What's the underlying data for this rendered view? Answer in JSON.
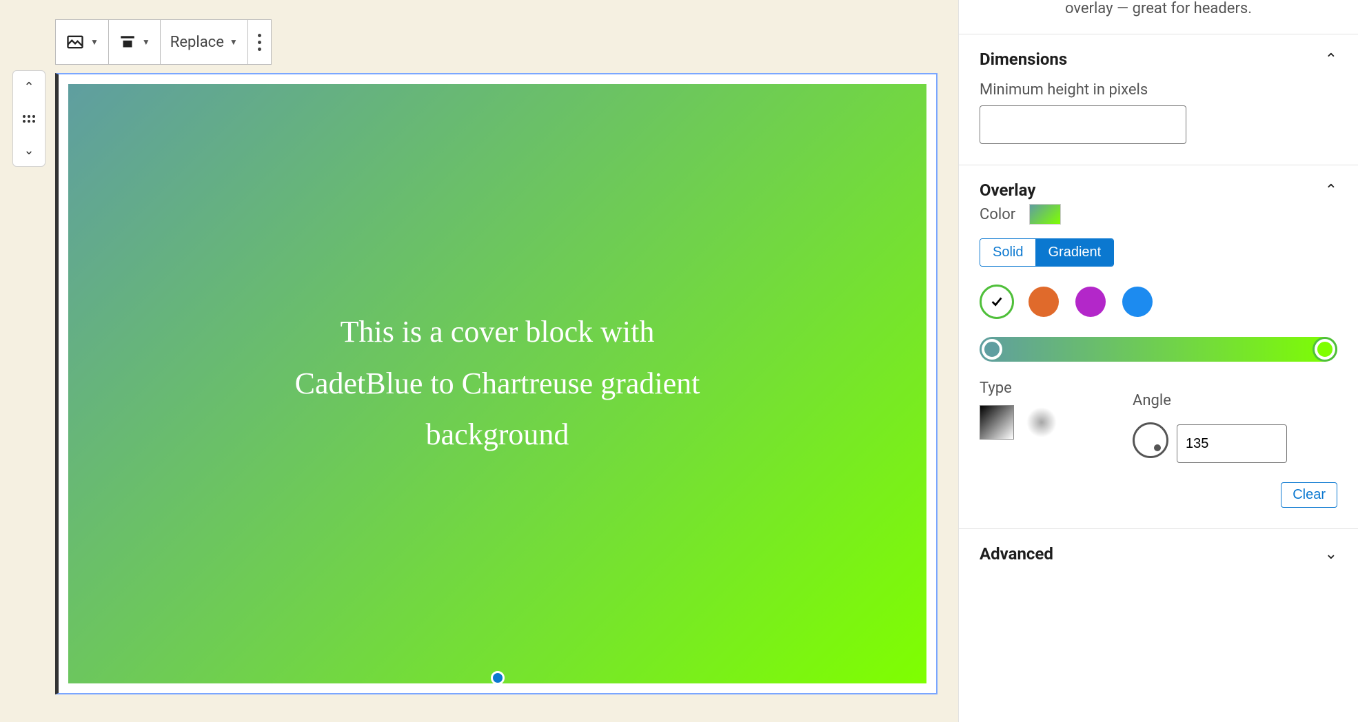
{
  "toolbar": {
    "replace_label": "Replace"
  },
  "cover": {
    "text": "This is a cover block with CadetBlue to Chartreuse gradient background",
    "gradient_start": "#5f9ea0",
    "gradient_end": "#7fff00"
  },
  "sidebar": {
    "help_text": "overlay — great for headers.",
    "dimensions": {
      "title": "Dimensions",
      "min_height_label": "Minimum height in pixels",
      "min_height_value": ""
    },
    "overlay": {
      "title": "Overlay",
      "color_label": "Color",
      "tabs": {
        "solid": "Solid",
        "gradient": "Gradient"
      },
      "swatches": [
        "selected",
        "#e06a2b",
        "#b327c9",
        "#1c8bf0"
      ],
      "type_label": "Type",
      "angle_label": "Angle",
      "angle_value": "135",
      "clear_label": "Clear"
    },
    "advanced": {
      "title": "Advanced"
    }
  }
}
